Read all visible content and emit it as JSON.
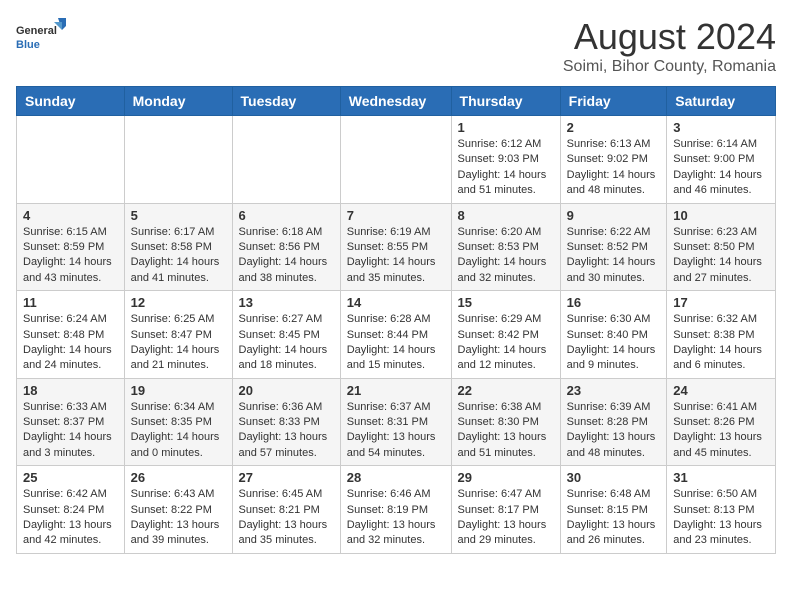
{
  "logo": {
    "general": "General",
    "blue": "Blue"
  },
  "header": {
    "month_year": "August 2024",
    "location": "Soimi, Bihor County, Romania"
  },
  "days_of_week": [
    "Sunday",
    "Monday",
    "Tuesday",
    "Wednesday",
    "Thursday",
    "Friday",
    "Saturday"
  ],
  "weeks": [
    [
      {
        "day": "",
        "info": ""
      },
      {
        "day": "",
        "info": ""
      },
      {
        "day": "",
        "info": ""
      },
      {
        "day": "",
        "info": ""
      },
      {
        "day": "1",
        "info": "Sunrise: 6:12 AM\nSunset: 9:03 PM\nDaylight: 14 hours and 51 minutes."
      },
      {
        "day": "2",
        "info": "Sunrise: 6:13 AM\nSunset: 9:02 PM\nDaylight: 14 hours and 48 minutes."
      },
      {
        "day": "3",
        "info": "Sunrise: 6:14 AM\nSunset: 9:00 PM\nDaylight: 14 hours and 46 minutes."
      }
    ],
    [
      {
        "day": "4",
        "info": "Sunrise: 6:15 AM\nSunset: 8:59 PM\nDaylight: 14 hours and 43 minutes."
      },
      {
        "day": "5",
        "info": "Sunrise: 6:17 AM\nSunset: 8:58 PM\nDaylight: 14 hours and 41 minutes."
      },
      {
        "day": "6",
        "info": "Sunrise: 6:18 AM\nSunset: 8:56 PM\nDaylight: 14 hours and 38 minutes."
      },
      {
        "day": "7",
        "info": "Sunrise: 6:19 AM\nSunset: 8:55 PM\nDaylight: 14 hours and 35 minutes."
      },
      {
        "day": "8",
        "info": "Sunrise: 6:20 AM\nSunset: 8:53 PM\nDaylight: 14 hours and 32 minutes."
      },
      {
        "day": "9",
        "info": "Sunrise: 6:22 AM\nSunset: 8:52 PM\nDaylight: 14 hours and 30 minutes."
      },
      {
        "day": "10",
        "info": "Sunrise: 6:23 AM\nSunset: 8:50 PM\nDaylight: 14 hours and 27 minutes."
      }
    ],
    [
      {
        "day": "11",
        "info": "Sunrise: 6:24 AM\nSunset: 8:48 PM\nDaylight: 14 hours and 24 minutes."
      },
      {
        "day": "12",
        "info": "Sunrise: 6:25 AM\nSunset: 8:47 PM\nDaylight: 14 hours and 21 minutes."
      },
      {
        "day": "13",
        "info": "Sunrise: 6:27 AM\nSunset: 8:45 PM\nDaylight: 14 hours and 18 minutes."
      },
      {
        "day": "14",
        "info": "Sunrise: 6:28 AM\nSunset: 8:44 PM\nDaylight: 14 hours and 15 minutes."
      },
      {
        "day": "15",
        "info": "Sunrise: 6:29 AM\nSunset: 8:42 PM\nDaylight: 14 hours and 12 minutes."
      },
      {
        "day": "16",
        "info": "Sunrise: 6:30 AM\nSunset: 8:40 PM\nDaylight: 14 hours and 9 minutes."
      },
      {
        "day": "17",
        "info": "Sunrise: 6:32 AM\nSunset: 8:38 PM\nDaylight: 14 hours and 6 minutes."
      }
    ],
    [
      {
        "day": "18",
        "info": "Sunrise: 6:33 AM\nSunset: 8:37 PM\nDaylight: 14 hours and 3 minutes."
      },
      {
        "day": "19",
        "info": "Sunrise: 6:34 AM\nSunset: 8:35 PM\nDaylight: 14 hours and 0 minutes."
      },
      {
        "day": "20",
        "info": "Sunrise: 6:36 AM\nSunset: 8:33 PM\nDaylight: 13 hours and 57 minutes."
      },
      {
        "day": "21",
        "info": "Sunrise: 6:37 AM\nSunset: 8:31 PM\nDaylight: 13 hours and 54 minutes."
      },
      {
        "day": "22",
        "info": "Sunrise: 6:38 AM\nSunset: 8:30 PM\nDaylight: 13 hours and 51 minutes."
      },
      {
        "day": "23",
        "info": "Sunrise: 6:39 AM\nSunset: 8:28 PM\nDaylight: 13 hours and 48 minutes."
      },
      {
        "day": "24",
        "info": "Sunrise: 6:41 AM\nSunset: 8:26 PM\nDaylight: 13 hours and 45 minutes."
      }
    ],
    [
      {
        "day": "25",
        "info": "Sunrise: 6:42 AM\nSunset: 8:24 PM\nDaylight: 13 hours and 42 minutes."
      },
      {
        "day": "26",
        "info": "Sunrise: 6:43 AM\nSunset: 8:22 PM\nDaylight: 13 hours and 39 minutes."
      },
      {
        "day": "27",
        "info": "Sunrise: 6:45 AM\nSunset: 8:21 PM\nDaylight: 13 hours and 35 minutes."
      },
      {
        "day": "28",
        "info": "Sunrise: 6:46 AM\nSunset: 8:19 PM\nDaylight: 13 hours and 32 minutes."
      },
      {
        "day": "29",
        "info": "Sunrise: 6:47 AM\nSunset: 8:17 PM\nDaylight: 13 hours and 29 minutes."
      },
      {
        "day": "30",
        "info": "Sunrise: 6:48 AM\nSunset: 8:15 PM\nDaylight: 13 hours and 26 minutes."
      },
      {
        "day": "31",
        "info": "Sunrise: 6:50 AM\nSunset: 8:13 PM\nDaylight: 13 hours and 23 minutes."
      }
    ]
  ]
}
